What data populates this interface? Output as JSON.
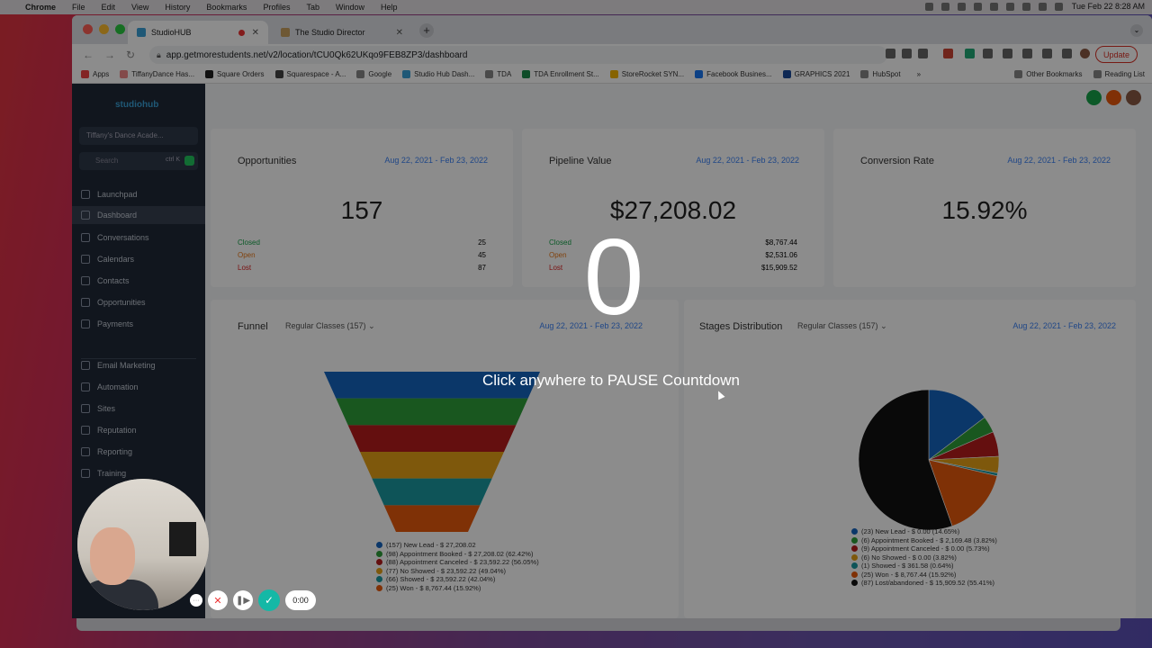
{
  "menubar": {
    "app": "Chrome",
    "items": [
      "File",
      "Edit",
      "View",
      "History",
      "Bookmarks",
      "Profiles",
      "Tab",
      "Window",
      "Help"
    ],
    "clock": "Tue Feb 22  8:28 AM"
  },
  "browser": {
    "tabs": [
      {
        "title": "StudioHUB"
      },
      {
        "title": "The Studio Director"
      }
    ],
    "url": "app.getmorestudents.net/v2/location/tCU0Qk62UKqo9FEB8ZP3/dashboard",
    "update_label": "Update",
    "bookmarks": [
      "Apps",
      "TiffanyDance Has...",
      "Square Orders",
      "Squarespace - A...",
      "Google",
      "Studio Hub Dash...",
      "TDA",
      "TDA Enrollment St...",
      "StoreRocket SYN...",
      "Facebook Busines...",
      "GRAPHICS 2021",
      "HubSpot"
    ],
    "bookmarks_overflow": "»",
    "other_bookmarks": "Other Bookmarks",
    "reading_list": "Reading List"
  },
  "sidebar": {
    "logo": "studiohub",
    "location": "Tiffany's Dance Acade...",
    "search_placeholder": "Search",
    "search_shortcut": "ctrl K",
    "items": [
      {
        "label": "Launchpad",
        "icon": "rocket-icon"
      },
      {
        "label": "Dashboard",
        "icon": "dashboard-icon",
        "active": true
      },
      {
        "label": "Conversations",
        "icon": "chat-icon"
      },
      {
        "label": "Calendars",
        "icon": "calendar-icon"
      },
      {
        "label": "Contacts",
        "icon": "contacts-icon"
      },
      {
        "label": "Opportunities",
        "icon": "funnel-icon"
      },
      {
        "label": "Payments",
        "icon": "payments-icon"
      }
    ],
    "items2": [
      {
        "label": "Email Marketing",
        "icon": "send-icon"
      },
      {
        "label": "Automation",
        "icon": "automation-icon"
      },
      {
        "label": "Sites",
        "icon": "globe-icon"
      },
      {
        "label": "Reputation",
        "icon": "star-icon"
      },
      {
        "label": "Reporting",
        "icon": "chart-icon"
      },
      {
        "label": "Training",
        "icon": "book-icon"
      }
    ]
  },
  "cards": {
    "opportunities": {
      "title": "Opportunities",
      "date": "Aug 22, 2021 - Feb 23, 2022",
      "value": "157",
      "stats": [
        {
          "label": "Closed",
          "value": "25",
          "color": "#16a34a"
        },
        {
          "label": "Open",
          "value": "45",
          "color": "#ea7a1a"
        },
        {
          "label": "Lost",
          "value": "87",
          "color": "#dc2626"
        }
      ]
    },
    "pipeline": {
      "title": "Pipeline Value",
      "date": "Aug 22, 2021 - Feb 23, 2022",
      "value": "$27,208.02",
      "stats": [
        {
          "label": "Closed",
          "value": "$8,767.44",
          "color": "#16a34a"
        },
        {
          "label": "Open",
          "value": "$2,531.06",
          "color": "#ea7a1a"
        },
        {
          "label": "Lost",
          "value": "$15,909.52",
          "color": "#dc2626"
        }
      ]
    },
    "conversion": {
      "title": "Conversion Rate",
      "date": "Aug 22, 2021 - Feb 23, 2022",
      "value": "15.92%"
    },
    "funnel": {
      "title": "Funnel",
      "dropdown": "Regular Classes (157)",
      "date": "Aug 22, 2021 - Feb 23, 2022",
      "legend": [
        {
          "text": "(157) New Lead - $ 27,208.02",
          "color": "#1565c0"
        },
        {
          "text": "(98) Appointment Booked - $ 27,208.02 (62.42%)",
          "color": "#2e9e3a"
        },
        {
          "text": "(88) Appointment Canceled - $ 23,592.22 (56.05%)",
          "color": "#b71c1c"
        },
        {
          "text": "(77) No Showed - $ 23,592.22 (49.04%)",
          "color": "#e6a117"
        },
        {
          "text": "(66) Showed - $ 23,592.22 (42.04%)",
          "color": "#1a9aa0"
        },
        {
          "text": "(25) Won - $ 8,767.44 (15.92%)",
          "color": "#e8590c"
        }
      ]
    },
    "stages": {
      "title": "Stages Distribution",
      "dropdown": "Regular Classes (157)",
      "date": "Aug 22, 2021 - Feb 23, 2022",
      "legend": [
        {
          "text": "(23) New Lead - $ 0.00 (14.65%)",
          "color": "#1565c0"
        },
        {
          "text": "(6) Appointment Booked - $ 2,169.48 (3.82%)",
          "color": "#2e9e3a"
        },
        {
          "text": "(9) Appointment Canceled - $ 0.00 (5.73%)",
          "color": "#b71c1c"
        },
        {
          "text": "(6) No Showed - $ 0.00 (3.82%)",
          "color": "#e6a117"
        },
        {
          "text": "(1) Showed - $ 361.58 (0.64%)",
          "color": "#1a9aa0"
        },
        {
          "text": "(25) Won - $ 8,767.44 (15.92%)",
          "color": "#e8590c"
        },
        {
          "text": "(87) Lost/abandoned - $ 15,909.52 (55.41%)",
          "color": "#111111"
        }
      ]
    }
  },
  "chart_data": [
    {
      "type": "bar",
      "title": "Funnel",
      "categories": [
        "New Lead",
        "Appointment Booked",
        "Appointment Canceled",
        "No Showed",
        "Showed",
        "Won"
      ],
      "values": [
        157,
        98,
        88,
        77,
        66,
        25
      ]
    },
    {
      "type": "pie",
      "title": "Stages Distribution",
      "categories": [
        "New Lead",
        "Appointment Booked",
        "Appointment Canceled",
        "No Showed",
        "Showed",
        "Won",
        "Lost/abandoned"
      ],
      "values": [
        14.65,
        3.82,
        5.73,
        3.82,
        0.64,
        15.92,
        55.41
      ]
    }
  ],
  "overlay": {
    "countdown": "0",
    "message": "Click anywhere to PAUSE Countdown"
  },
  "recorder": {
    "timer": "0:00",
    "more": "···"
  }
}
